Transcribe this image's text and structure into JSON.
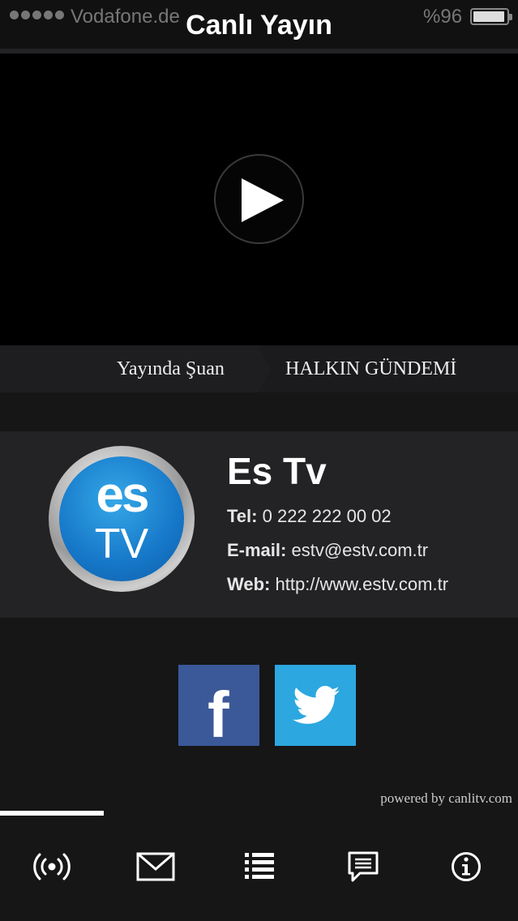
{
  "status_bar": {
    "carrier": "Vodafone.de",
    "battery_percent": "%96",
    "battery_level": 0.96,
    "signal_bars": 5
  },
  "header": {
    "title": "Canlı Yayın"
  },
  "player": {
    "play_icon": "play-icon"
  },
  "now_playing": {
    "label": "Yayında Şuan",
    "show": "HALKIN GÜNDEMİ"
  },
  "channel": {
    "logo_text_top": "es",
    "logo_text_bottom": "TV",
    "name": "Es Tv",
    "tel_label": "Tel:",
    "tel_value": "0 222 222 00 02",
    "email_label": "E-mail:",
    "email_value": "estv@estv.com.tr",
    "web_label": "Web:",
    "web_value": "http://www.estv.com.tr"
  },
  "social": {
    "facebook_glyph": "f",
    "facebook_color": "#3b5998",
    "twitter_color": "#2ca7e0"
  },
  "footer": {
    "powered_by": "powered by canlitv.com"
  },
  "tabs": [
    {
      "icon": "broadcast-icon",
      "active": true
    },
    {
      "icon": "mail-icon",
      "active": false
    },
    {
      "icon": "list-icon",
      "active": false
    },
    {
      "icon": "chat-icon",
      "active": false
    },
    {
      "icon": "info-icon",
      "active": false
    }
  ]
}
